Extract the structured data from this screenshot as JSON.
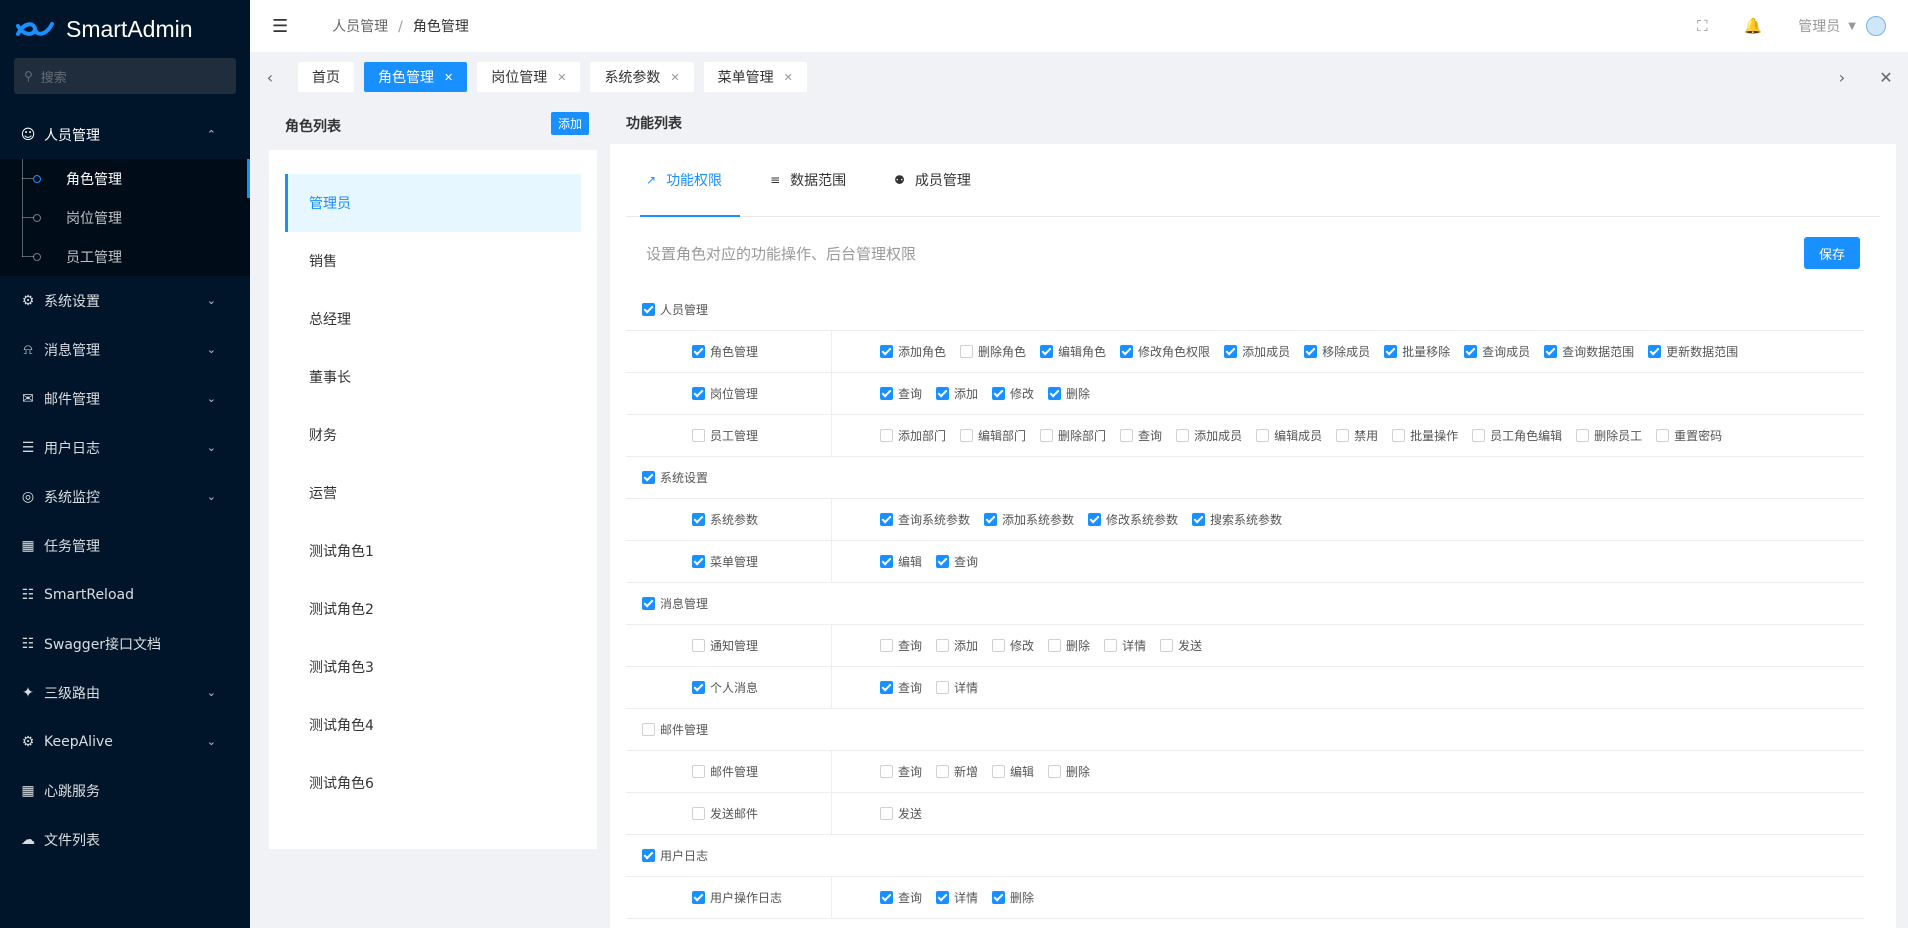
{
  "app": {
    "name": "SmartAdmin"
  },
  "sidebar": {
    "search_placeholder": "搜索",
    "groups": [
      {
        "label": "人员管理",
        "icon": "user-icon",
        "open": true,
        "children": [
          "角色管理",
          "岗位管理",
          "员工管理"
        ],
        "active_child": 0
      },
      {
        "label": "系统设置",
        "icon": "gear-icon",
        "open": false
      },
      {
        "label": "消息管理",
        "icon": "bell-icon",
        "open": false
      },
      {
        "label": "邮件管理",
        "icon": "mail-icon",
        "open": false
      },
      {
        "label": "用户日志",
        "icon": "log-icon",
        "open": false
      },
      {
        "label": "系统监控",
        "icon": "monitor-icon",
        "open": false
      },
      {
        "label": "任务管理",
        "icon": "calendar-icon",
        "open": null
      },
      {
        "label": "SmartReload",
        "icon": "reload-icon",
        "open": null
      },
      {
        "label": "Swagger接口文档",
        "icon": "doc-icon",
        "open": null
      },
      {
        "label": "三级路由",
        "icon": "puzzle-icon",
        "open": false
      },
      {
        "label": "KeepAlive",
        "icon": "gear-icon",
        "open": false
      },
      {
        "label": "心跳服务",
        "icon": "calendar-icon",
        "open": null
      },
      {
        "label": "文件列表",
        "icon": "cloud-icon",
        "open": null
      }
    ]
  },
  "header": {
    "breadcrumb": [
      "人员管理",
      "角色管理"
    ],
    "separator": "/",
    "user": "管理员"
  },
  "tabs": [
    {
      "label": "首页",
      "closable": false,
      "active": false
    },
    {
      "label": "角色管理",
      "closable": true,
      "active": true
    },
    {
      "label": "岗位管理",
      "closable": true,
      "active": false
    },
    {
      "label": "系统参数",
      "closable": true,
      "active": false
    },
    {
      "label": "菜单管理",
      "closable": true,
      "active": false
    }
  ],
  "roles": {
    "title": "角色列表",
    "add_label": "添加",
    "items": [
      "管理员",
      "销售",
      "总经理",
      "董事长",
      "财务",
      "运营",
      "测试角色1",
      "测试角色2",
      "测试角色3",
      "测试角色4",
      "测试角色6"
    ],
    "active": 0
  },
  "function": {
    "title": "功能列表",
    "tabs": [
      {
        "label": "功能权限",
        "icon": "pencil-icon",
        "active": true
      },
      {
        "label": "数据范围",
        "icon": "list-icon",
        "active": false
      },
      {
        "label": "成员管理",
        "icon": "team-icon",
        "active": false
      }
    ],
    "description": "设置角色对应的功能操作、后台管理权限",
    "save_label": "保存",
    "groups": [
      {
        "label": "人员管理",
        "checked": true,
        "rows": [
          {
            "label": "角色管理",
            "checked": true,
            "actions": [
              [
                "添加角色",
                true
              ],
              [
                "删除角色",
                false
              ],
              [
                "编辑角色",
                true
              ],
              [
                "修改角色权限",
                true
              ],
              [
                "添加成员",
                true
              ],
              [
                "移除成员",
                true
              ],
              [
                "批量移除",
                true
              ],
              [
                "查询成员",
                true
              ],
              [
                "查询数据范围",
                true
              ],
              [
                "更新数据范围",
                true
              ]
            ]
          },
          {
            "label": "岗位管理",
            "checked": true,
            "actions": [
              [
                "查询",
                true
              ],
              [
                "添加",
                true
              ],
              [
                "修改",
                true
              ],
              [
                "删除",
                true
              ]
            ]
          },
          {
            "label": "员工管理",
            "checked": false,
            "actions": [
              [
                "添加部门",
                false
              ],
              [
                "编辑部门",
                false
              ],
              [
                "删除部门",
                false
              ],
              [
                "查询",
                false
              ],
              [
                "添加成员",
                false
              ],
              [
                "编辑成员",
                false
              ],
              [
                "禁用",
                false
              ],
              [
                "批量操作",
                false
              ],
              [
                "员工角色编辑",
                false
              ],
              [
                "删除员工",
                false
              ],
              [
                "重置密码",
                false
              ]
            ]
          }
        ]
      },
      {
        "label": "系统设置",
        "checked": true,
        "rows": [
          {
            "label": "系统参数",
            "checked": true,
            "actions": [
              [
                "查询系统参数",
                true
              ],
              [
                "添加系统参数",
                true
              ],
              [
                "修改系统参数",
                true
              ],
              [
                "搜索系统参数",
                true
              ]
            ]
          },
          {
            "label": "菜单管理",
            "checked": true,
            "actions": [
              [
                "编辑",
                true
              ],
              [
                "查询",
                true
              ]
            ]
          }
        ]
      },
      {
        "label": "消息管理",
        "checked": true,
        "rows": [
          {
            "label": "通知管理",
            "checked": false,
            "actions": [
              [
                "查询",
                false
              ],
              [
                "添加",
                false
              ],
              [
                "修改",
                false
              ],
              [
                "删除",
                false
              ],
              [
                "详情",
                false
              ],
              [
                "发送",
                false
              ]
            ]
          },
          {
            "label": "个人消息",
            "checked": true,
            "actions": [
              [
                "查询",
                true
              ],
              [
                "详情",
                false
              ]
            ]
          }
        ]
      },
      {
        "label": "邮件管理",
        "checked": false,
        "rows": [
          {
            "label": "邮件管理",
            "checked": false,
            "actions": [
              [
                "查询",
                false
              ],
              [
                "新增",
                false
              ],
              [
                "编辑",
                false
              ],
              [
                "删除",
                false
              ]
            ]
          },
          {
            "label": "发送邮件",
            "checked": false,
            "actions": [
              [
                "发送",
                false
              ]
            ]
          }
        ]
      },
      {
        "label": "用户日志",
        "checked": true,
        "rows": [
          {
            "label": "用户操作日志",
            "checked": true,
            "actions": [
              [
                "查询",
                true
              ],
              [
                "详情",
                true
              ],
              [
                "删除",
                true
              ]
            ]
          }
        ]
      }
    ]
  },
  "colors": {
    "primary": "#1890ff",
    "sidebar_bg": "#001529"
  }
}
